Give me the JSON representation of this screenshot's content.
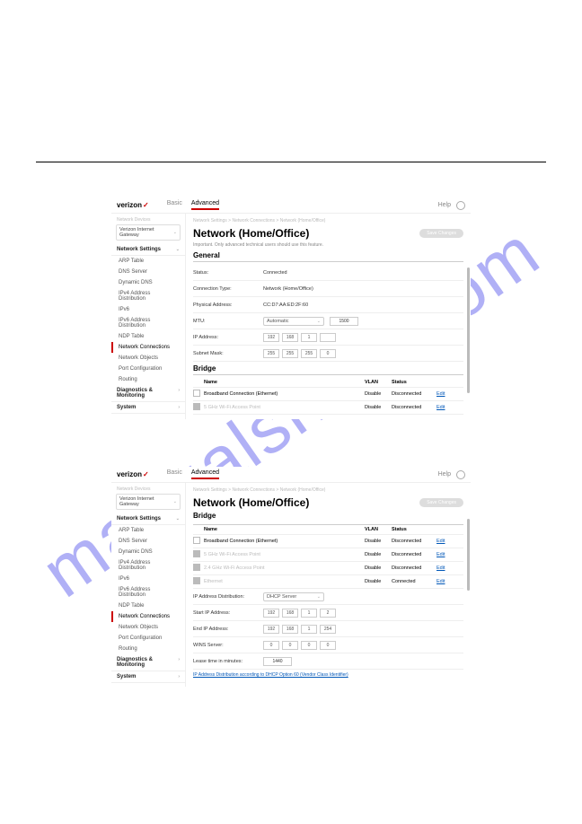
{
  "brand": "verizon",
  "tabs": {
    "basic": "Basic",
    "advanced": "Advanced"
  },
  "help": "Help",
  "sidebar": {
    "device_label": "Network Devices",
    "device": "Verizon Internet Gateway",
    "net_settings": "Network Settings",
    "items": [
      "ARP Table",
      "DNS Server",
      "Dynamic DNS",
      "IPv4 Address Distribution",
      "IPv6",
      "IPv6 Address Distribution",
      "NDP Table",
      "Network Connections",
      "Network Objects",
      "Port Configuration",
      "Routing"
    ],
    "diag": "Diagnostics & Monitoring",
    "system": "System"
  },
  "crumbs": "Network Settings  >  Network Connections  >  Network (Home/Office)",
  "title": "Network (Home/Office)",
  "save": "Save Changes",
  "warn": "Important. Only advanced technical users should use this feature.",
  "general": {
    "heading": "General",
    "status": {
      "l": "Status:",
      "v": "Connected"
    },
    "ctype": {
      "l": "Connection Type:",
      "v": "Network (Home/Office)"
    },
    "paddr": {
      "l": "Physical Address:",
      "v": "CC:D7:AA:ED:2F:60"
    },
    "mtu": {
      "l": "MTU:",
      "sel": "Automatic",
      "v": "1500"
    },
    "ip": {
      "l": "IP Address:",
      "o": [
        "192",
        "168",
        "1",
        ""
      ]
    },
    "mask": {
      "l": "Subnet Mask:",
      "o": [
        "255",
        "255",
        "255",
        "0"
      ]
    }
  },
  "bridge": {
    "heading": "Bridge",
    "cols": {
      "name": "Name",
      "vlan": "VLAN",
      "status": "Status"
    },
    "rows": [
      {
        "chk": false,
        "name": "Broadband Connection (Ethernet)",
        "vlan": "Disable",
        "status": "Disconnected",
        "act": "Edit"
      },
      {
        "chk": true,
        "name": "5 GHz Wi-Fi Access Point",
        "vlan": "Disable",
        "status": "Disconnected",
        "act": "Edit"
      }
    ]
  },
  "bridge2": {
    "heading": "Bridge",
    "cols": {
      "name": "Name",
      "vlan": "VLAN",
      "status": "Status"
    },
    "rows": [
      {
        "chk": false,
        "name": "Broadband Connection (Ethernet)",
        "vlan": "Disable",
        "status": "Disconnected",
        "act": "Edit"
      },
      {
        "chk": true,
        "name": "5 GHz Wi-Fi Access Point",
        "vlan": "Disable",
        "status": "Disconnected",
        "act": "Edit"
      },
      {
        "chk": true,
        "name": "2.4 GHz Wi-Fi Access Point",
        "vlan": "Disable",
        "status": "Disconnected",
        "act": "Edit"
      },
      {
        "chk": true,
        "name": "Ethernet",
        "vlan": "Disable",
        "status": "Connected",
        "act": "Edit"
      }
    ]
  },
  "dist": {
    "l": "IP Address Distribution:",
    "v": "DHCP Server",
    "start": {
      "l": "Start IP Address:",
      "o": [
        "192",
        "168",
        "1",
        "2"
      ]
    },
    "end": {
      "l": "End IP Address:",
      "o": [
        "192",
        "168",
        "1",
        "254"
      ]
    },
    "wins": {
      "l": "WINS Server:",
      "o": [
        "0",
        "0",
        "0",
        "0"
      ]
    },
    "lease": {
      "l": "Lease time in minutes:",
      "v": "1440"
    },
    "link": "IP Address Distribution according to DHCP Option 60 (Vendor Class Identifier)"
  }
}
